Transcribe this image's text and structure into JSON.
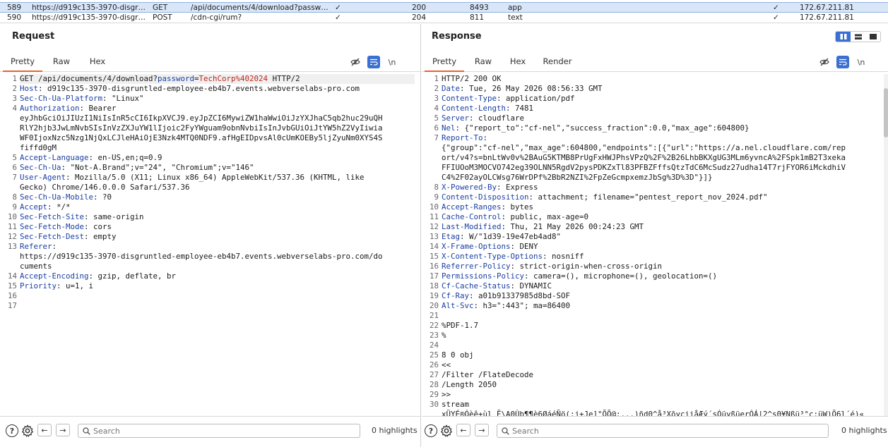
{
  "history": {
    "rows": [
      {
        "num": "589",
        "host": "https://d919c135-3970-disgrun…",
        "method": "GET",
        "url": "/api/documents/4/download?passwor…",
        "params": "✓",
        "status": "200",
        "length": "8493",
        "mime": "app",
        "tls": "✓",
        "ip": "172.67.211.81"
      },
      {
        "num": "590",
        "host": "https://d919c135-3970-disgrun…",
        "method": "POST",
        "url": "/cdn-cgi/rum?",
        "params": "✓",
        "status": "204",
        "length": "811",
        "mime": "text",
        "tls": "✓",
        "ip": "172.67.211.81"
      }
    ]
  },
  "request": {
    "title": "Request",
    "tabs": [
      "Pretty",
      "Raw",
      "Hex"
    ],
    "newline_toggle": "\\n",
    "lines": [
      {
        "n": "1",
        "parts": [
          [
            "t",
            "GET /api/documents/4/download?"
          ],
          [
            "k",
            "password"
          ],
          [
            "t",
            "="
          ],
          [
            "p",
            "TechCorp%402024"
          ],
          [
            "t",
            " HTTP/2"
          ]
        ]
      },
      {
        "n": "2",
        "parts": [
          [
            "k",
            "Host"
          ],
          [
            "t",
            ": d919c135-3970-disgruntled-employee-eb4b7.events.webverselabs-pro.com"
          ]
        ]
      },
      {
        "n": "3",
        "parts": [
          [
            "k",
            "Sec-Ch-Ua-Platform"
          ],
          [
            "t",
            ": \"Linux\""
          ]
        ]
      },
      {
        "n": "4",
        "parts": [
          [
            "k",
            "Authorization"
          ],
          [
            "t",
            ": Bearer"
          ]
        ]
      },
      {
        "n": "",
        "parts": [
          [
            "t",
            "eyJhbGciOiJIUzI1NiIsInR5cCI6IkpXVCJ9.eyJpZCI6MywiZW1haWwiOiJzYXJhaC5qb2huc29uQH"
          ]
        ]
      },
      {
        "n": "",
        "parts": [
          [
            "t",
            "RlY2hjb3JwLmNvbSIsInVzZXJuYW1lIjoic2FyYWguam9obnNvbiIsInJvbGUiOiJtYW5hZ2VyIiwia"
          ]
        ]
      },
      {
        "n": "",
        "parts": [
          [
            "t",
            "WF0IjoxNzc5Nzg1NjQxLCJleHAiOjE3Nzk4MTQ0NDF9.afHgEIDpvsAl0cUmKOEBy5ljZyuNm0XYS4S"
          ]
        ]
      },
      {
        "n": "",
        "parts": [
          [
            "t",
            "fiffd0gM"
          ]
        ]
      },
      {
        "n": "5",
        "parts": [
          [
            "k",
            "Accept-Language"
          ],
          [
            "t",
            ": en-US,en;q=0.9"
          ]
        ]
      },
      {
        "n": "6",
        "parts": [
          [
            "k",
            "Sec-Ch-Ua"
          ],
          [
            "t",
            ": \"Not-A.Brand\";v=\"24\", \"Chromium\";v=\"146\""
          ]
        ]
      },
      {
        "n": "7",
        "parts": [
          [
            "k",
            "User-Agent"
          ],
          [
            "t",
            ": Mozilla/5.0 (X11; Linux x86_64) AppleWebKit/537.36 (KHTML, like"
          ]
        ]
      },
      {
        "n": "",
        "parts": [
          [
            "t",
            "Gecko) Chrome/146.0.0.0 Safari/537.36"
          ]
        ]
      },
      {
        "n": "8",
        "parts": [
          [
            "k",
            "Sec-Ch-Ua-Mobile"
          ],
          [
            "t",
            ": ?0"
          ]
        ]
      },
      {
        "n": "9",
        "parts": [
          [
            "k",
            "Accept"
          ],
          [
            "t",
            ": */*"
          ]
        ]
      },
      {
        "n": "10",
        "parts": [
          [
            "k",
            "Sec-Fetch-Site"
          ],
          [
            "t",
            ": same-origin"
          ]
        ]
      },
      {
        "n": "11",
        "parts": [
          [
            "k",
            "Sec-Fetch-Mode"
          ],
          [
            "t",
            ": cors"
          ]
        ]
      },
      {
        "n": "12",
        "parts": [
          [
            "k",
            "Sec-Fetch-Dest"
          ],
          [
            "t",
            ": empty"
          ]
        ]
      },
      {
        "n": "13",
        "parts": [
          [
            "k",
            "Referer"
          ],
          [
            "t",
            ":"
          ]
        ]
      },
      {
        "n": "",
        "parts": [
          [
            "t",
            "https://d919c135-3970-disgruntled-employee-eb4b7.events.webverselabs-pro.com/do"
          ]
        ]
      },
      {
        "n": "",
        "parts": [
          [
            "t",
            "cuments"
          ]
        ]
      },
      {
        "n": "14",
        "parts": [
          [
            "k",
            "Accept-Encoding"
          ],
          [
            "t",
            ": gzip, deflate, br"
          ]
        ]
      },
      {
        "n": "15",
        "parts": [
          [
            "k",
            "Priority"
          ],
          [
            "t",
            ": u=1, i"
          ]
        ]
      },
      {
        "n": "16",
        "parts": []
      },
      {
        "n": "17",
        "parts": []
      }
    ],
    "search_placeholder": "Search",
    "highlights": "0 highlights"
  },
  "response": {
    "title": "Response",
    "tabs": [
      "Pretty",
      "Raw",
      "Hex",
      "Render"
    ],
    "newline_toggle": "\\n",
    "lines": [
      {
        "n": "1",
        "parts": [
          [
            "t",
            "HTTP/2 200 OK"
          ]
        ]
      },
      {
        "n": "2",
        "parts": [
          [
            "k",
            "Date"
          ],
          [
            "t",
            ": Tue, 26 May 2026 08:56:33 GMT"
          ]
        ]
      },
      {
        "n": "3",
        "parts": [
          [
            "k",
            "Content-Type"
          ],
          [
            "t",
            ": application/pdf"
          ]
        ]
      },
      {
        "n": "4",
        "parts": [
          [
            "k",
            "Content-Length"
          ],
          [
            "t",
            ": 7481"
          ]
        ]
      },
      {
        "n": "5",
        "parts": [
          [
            "k",
            "Server"
          ],
          [
            "t",
            ": cloudflare"
          ]
        ]
      },
      {
        "n": "6",
        "parts": [
          [
            "k",
            "Nel"
          ],
          [
            "t",
            ": {\"report_to\":\"cf-nel\",\"success_fraction\":0.0,\"max_age\":604800}"
          ]
        ]
      },
      {
        "n": "7",
        "parts": [
          [
            "k",
            "Report-To"
          ],
          [
            "t",
            ":"
          ]
        ]
      },
      {
        "n": "",
        "parts": [
          [
            "t",
            "{\"group\":\"cf-nel\",\"max_age\":604800,\"endpoints\":[{\"url\":\"https://a.nel.cloudflare.com/rep"
          ]
        ]
      },
      {
        "n": "",
        "parts": [
          [
            "t",
            "ort/v4?s=bnLtWv0v%2BAuG5KTMB8PrUgFxHWJPhsVPzQ%2F%2B26LhbBKXgUG3MLm6yvncA%2FSpk1mB2T3xeka"
          ]
        ]
      },
      {
        "n": "",
        "parts": [
          [
            "t",
            "FFIUOoM3MOCVO742eg39OLNN5RgdV2pysPDKZxTl83PFBZFffsQtzTdC6McSudz27udha14T7rjFYOR6iMckdhiV"
          ]
        ]
      },
      {
        "n": "",
        "parts": [
          [
            "t",
            "C4%2F02ayOLCWsg76WrDPf%2BbR2NZI%2FpZeGcmpxemzJbSg%3D%3D\"}]}"
          ]
        ]
      },
      {
        "n": "8",
        "parts": [
          [
            "k",
            "X-Powered-By"
          ],
          [
            "t",
            ": Express"
          ]
        ]
      },
      {
        "n": "9",
        "parts": [
          [
            "k",
            "Content-Disposition"
          ],
          [
            "t",
            ": attachment; filename=\"pentest_report_nov_2024.pdf\""
          ]
        ]
      },
      {
        "n": "10",
        "parts": [
          [
            "k",
            "Accept-Ranges"
          ],
          [
            "t",
            ": bytes"
          ]
        ]
      },
      {
        "n": "11",
        "parts": [
          [
            "k",
            "Cache-Control"
          ],
          [
            "t",
            ": public, max-age=0"
          ]
        ]
      },
      {
        "n": "12",
        "parts": [
          [
            "k",
            "Last-Modified"
          ],
          [
            "t",
            ": Thu, 21 May 2026 00:24:23 GMT"
          ]
        ]
      },
      {
        "n": "13",
        "parts": [
          [
            "k",
            "Etag"
          ],
          [
            "t",
            ": W/\"1d39-19e47eb4ad8\""
          ]
        ]
      },
      {
        "n": "14",
        "parts": [
          [
            "k",
            "X-Frame-Options"
          ],
          [
            "t",
            ": DENY"
          ]
        ]
      },
      {
        "n": "15",
        "parts": [
          [
            "k",
            "X-Content-Type-Options"
          ],
          [
            "t",
            ": nosniff"
          ]
        ]
      },
      {
        "n": "16",
        "parts": [
          [
            "k",
            "Referrer-Policy"
          ],
          [
            "t",
            ": strict-origin-when-cross-origin"
          ]
        ]
      },
      {
        "n": "17",
        "parts": [
          [
            "k",
            "Permissions-Policy"
          ],
          [
            "t",
            ": camera=(), microphone=(), geolocation=()"
          ]
        ]
      },
      {
        "n": "18",
        "parts": [
          [
            "k",
            "Cf-Cache-Status"
          ],
          [
            "t",
            ": DYNAMIC"
          ]
        ]
      },
      {
        "n": "19",
        "parts": [
          [
            "k",
            "Cf-Ray"
          ],
          [
            "t",
            ": a01b91337985d8bd-SOF"
          ]
        ]
      },
      {
        "n": "20",
        "parts": [
          [
            "k",
            "Alt-Svc"
          ],
          [
            "t",
            ": h3=\":443\"; ma=86400"
          ]
        ]
      },
      {
        "n": "21",
        "parts": []
      },
      {
        "n": "22",
        "parts": [
          [
            "t",
            "%PDF-1.7"
          ]
        ]
      },
      {
        "n": "23",
        "parts": [
          [
            "t",
            "%"
          ]
        ]
      },
      {
        "n": "24",
        "parts": []
      },
      {
        "n": "25",
        "parts": [
          [
            "t",
            "8 0 obj"
          ]
        ]
      },
      {
        "n": "26",
        "parts": [
          [
            "t",
            "<<"
          ]
        ]
      },
      {
        "n": "27",
        "parts": [
          [
            "t",
            "/Filter /FlateDecode"
          ]
        ]
      },
      {
        "n": "28",
        "parts": [
          [
            "t",
            "/Length 2050"
          ]
        ]
      },
      {
        "n": "29",
        "parts": [
          [
            "t",
            ">>"
          ]
        ]
      },
      {
        "n": "30",
        "parts": [
          [
            "t",
            "stream"
          ]
        ]
      },
      {
        "n": "",
        "parts": [
          [
            "t",
            "xÜYÉ®Óèê+ùl Ë\\A0Ùb¶¶è6ØáéÑö(:j+Je]\"ÕÕ@:...)ñd0^å³XõyciiåÆý´sÓüyßüerÓÁ|2^s0¥Nßü³°c:üW)Ö6l´é)«"
          ]
        ]
      }
    ],
    "search_placeholder": "Search",
    "highlights": "0 highlights"
  }
}
